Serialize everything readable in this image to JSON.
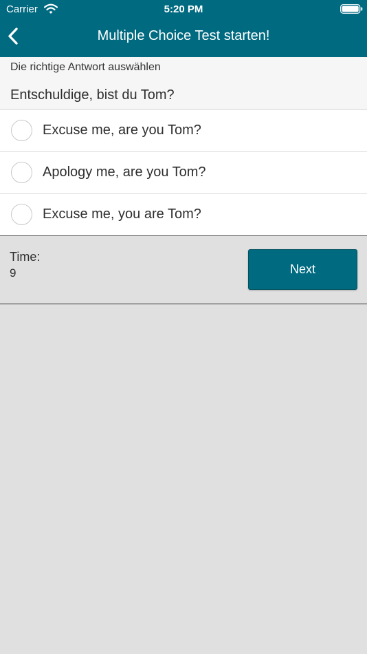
{
  "status_bar": {
    "carrier": "Carrier",
    "time": "5:20 PM",
    "icons": [
      "wifi-icon",
      "battery-icon"
    ]
  },
  "nav": {
    "title": "Multiple Choice Test starten!",
    "back_icon": "chevron-left-icon"
  },
  "quiz": {
    "instruction": "Die richtige Antwort auswählen",
    "question": "Entschuldige, bist du Tom?",
    "options": [
      {
        "label": "Excuse me, are you Tom?",
        "selected": false
      },
      {
        "label": "Apology me, are you Tom?",
        "selected": false
      },
      {
        "label": "Excuse me, you are Tom?",
        "selected": false
      }
    ]
  },
  "footer": {
    "time_label": "Time:",
    "time_value": "9",
    "next_label": "Next"
  },
  "colors": {
    "primary": "#006a80",
    "background": "#e0e0e0",
    "question_panel": "#f6f6f6",
    "text": "#2e2e2e"
  }
}
